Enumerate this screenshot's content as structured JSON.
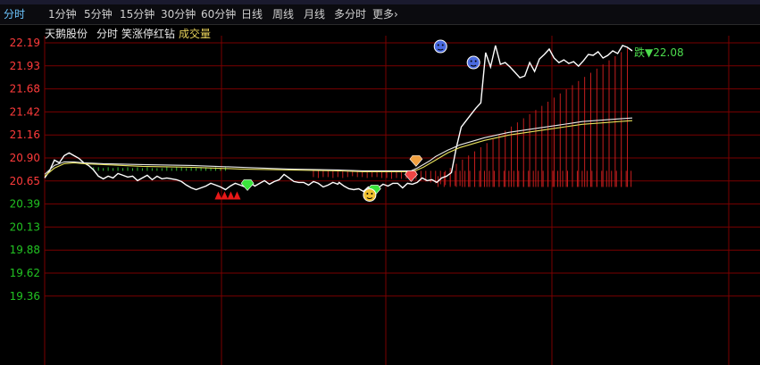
{
  "tabs": [
    {
      "label": "分时",
      "active": true
    },
    {
      "label": "1分钟"
    },
    {
      "label": "5分钟"
    },
    {
      "label": "15分钟"
    },
    {
      "label": "30分钟"
    },
    {
      "label": "60分钟"
    },
    {
      "label": "日线"
    },
    {
      "label": "周线"
    },
    {
      "label": "月线"
    },
    {
      "label": "多分时"
    },
    {
      "label": "更多"
    }
  ],
  "more_glyph": "›",
  "info": {
    "stock_name": "天鹅股份",
    "mode": "分时",
    "indicator": "笑涨停红钻",
    "volume_label": "成交量"
  },
  "colors": {
    "price_line": "#ffffff",
    "avg_line_yellow": "#e6e05a",
    "avg_line_white": "#e8e8e8",
    "grid": "#7a0000",
    "axis_up": "#ff3b3b",
    "axis_down": "#22c322",
    "bar_up": "#c41e1e",
    "bar_down": "#2fbf2f",
    "text_up": "#ff4d4d",
    "text_down": "#4ddc4d",
    "volume_label": "#e8d25a",
    "active_tab": "#6cc6ff"
  },
  "chart_data": {
    "type": "line",
    "ylim": [
      19.36,
      21.97
    ],
    "y_ticks": [
      "22.19",
      "21.93",
      "21.68",
      "21.42",
      "21.16",
      "20.90",
      "20.65",
      "20.39",
      "20.13",
      "19.88",
      "19.62",
      "19.36"
    ],
    "y_tick_up_count": 7,
    "series": [
      {
        "key": "price",
        "x": [
          0,
          4,
          8,
          12,
          16,
          20,
          24,
          28,
          32,
          36,
          40,
          44,
          48,
          52,
          56,
          60,
          64,
          68,
          72,
          76,
          80,
          84,
          88,
          92,
          96,
          100,
          104,
          108,
          112,
          116,
          120,
          124,
          128,
          132,
          136,
          140,
          144,
          148,
          152,
          156,
          160,
          164,
          168,
          172,
          176,
          180,
          184,
          188,
          192,
          196,
          200,
          204,
          208,
          212,
          216,
          220,
          224,
          228,
          232,
          236,
          240,
          241,
          245,
          249,
          253,
          257,
          261,
          265,
          269,
          273,
          277,
          281,
          285,
          289,
          293,
          297,
          301,
          305,
          309,
          313,
          317,
          321,
          325,
          329,
          333,
          337,
          341,
          345,
          349,
          353,
          357,
          361,
          365,
          369,
          373,
          377,
          381,
          385,
          389,
          393,
          397,
          401,
          405,
          409,
          413,
          417,
          421,
          425,
          429,
          433,
          437,
          441,
          445,
          449,
          453,
          457,
          461,
          465,
          469,
          473,
          477,
          481
        ],
        "values": [
          20.68,
          20.76,
          20.88,
          20.85,
          20.93,
          20.96,
          20.93,
          20.9,
          20.85,
          20.82,
          20.77,
          20.7,
          20.67,
          20.7,
          20.68,
          20.73,
          20.71,
          20.69,
          20.7,
          20.65,
          20.68,
          20.71,
          20.66,
          20.7,
          20.67,
          20.68,
          20.67,
          20.66,
          20.64,
          20.6,
          20.57,
          20.55,
          20.57,
          20.59,
          20.62,
          20.6,
          20.58,
          20.55,
          20.59,
          20.62,
          20.6,
          20.58,
          20.63,
          20.59,
          20.62,
          20.65,
          20.61,
          20.64,
          20.66,
          20.72,
          20.68,
          20.64,
          20.63,
          20.63,
          20.6,
          20.64,
          20.62,
          20.58,
          20.6,
          20.63,
          20.61,
          20.63,
          20.59,
          20.56,
          20.55,
          20.56,
          20.53,
          20.58,
          20.55,
          20.57,
          20.61,
          20.59,
          20.62,
          20.62,
          20.57,
          20.62,
          20.61,
          20.63,
          20.68,
          20.65,
          20.66,
          20.63,
          20.68,
          20.7,
          20.74,
          21.02,
          21.25,
          21.32,
          21.39,
          21.46,
          21.52,
          22.08,
          21.92,
          22.16,
          21.95,
          21.97,
          21.92,
          21.86,
          21.8,
          21.82,
          21.97,
          21.87,
          22.01,
          22.06,
          22.12,
          22.02,
          21.97,
          22.0,
          21.96,
          21.98,
          21.93,
          21.99,
          22.06,
          22.05,
          22.09,
          22.02,
          22.05,
          22.1,
          22.07,
          22.16,
          22.14,
          22.1
        ]
      },
      {
        "key": "avg_yellow",
        "x": [
          0,
          8,
          16,
          24,
          32,
          48,
          80,
          120,
          160,
          200,
          240,
          260,
          280,
          300,
          305,
          310,
          315,
          320,
          330,
          340,
          350,
          360,
          370,
          380,
          390,
          400,
          410,
          420,
          430,
          440,
          450,
          460,
          470,
          481
        ],
        "values": [
          20.7,
          20.79,
          20.84,
          20.85,
          20.84,
          20.83,
          20.81,
          20.8,
          20.78,
          20.77,
          20.76,
          20.75,
          20.75,
          20.75,
          20.77,
          20.8,
          20.84,
          20.88,
          20.96,
          21.02,
          21.06,
          21.1,
          21.13,
          21.16,
          21.18,
          21.2,
          21.22,
          21.24,
          21.26,
          21.28,
          21.29,
          21.3,
          21.31,
          21.32
        ]
      },
      {
        "key": "avg_white",
        "x": [
          0,
          8,
          16,
          24,
          32,
          48,
          80,
          120,
          160,
          200,
          240,
          260,
          280,
          300,
          305,
          310,
          315,
          320,
          330,
          340,
          350,
          360,
          370,
          380,
          390,
          400,
          410,
          420,
          430,
          440,
          450,
          460,
          470,
          481
        ],
        "values": [
          20.72,
          20.82,
          20.86,
          20.86,
          20.85,
          20.84,
          20.83,
          20.82,
          20.8,
          20.78,
          20.77,
          20.76,
          20.76,
          20.76,
          20.79,
          20.83,
          20.87,
          20.92,
          20.99,
          21.05,
          21.09,
          21.13,
          21.16,
          21.19,
          21.21,
          21.23,
          21.25,
          21.27,
          21.29,
          21.31,
          21.32,
          21.33,
          21.34,
          21.35
        ]
      }
    ],
    "signal_bars": {
      "base": 20.76,
      "x": [
        40,
        44,
        48,
        52,
        56,
        60,
        64,
        68,
        72,
        76,
        80,
        84,
        88,
        92,
        96,
        100,
        104,
        108,
        112,
        116,
        120,
        124,
        128,
        132,
        136,
        140,
        144,
        148,
        220,
        224,
        228,
        232,
        236,
        240,
        244,
        248,
        252,
        256,
        260,
        264,
        268,
        272,
        276,
        280,
        284,
        288,
        292,
        296,
        300,
        304,
        308,
        312,
        316,
        320,
        324,
        328,
        332,
        336,
        340,
        344,
        348,
        352,
        356,
        360,
        364,
        368,
        372,
        376,
        380,
        384,
        388,
        392,
        396,
        400,
        404,
        408,
        412,
        416,
        420,
        424,
        428,
        432,
        436,
        440,
        444,
        448,
        452,
        456,
        460,
        464,
        468,
        472,
        476,
        480
      ],
      "values": [
        20.8,
        20.8,
        20.79,
        20.8,
        20.79,
        20.8,
        20.79,
        20.8,
        20.79,
        20.8,
        20.79,
        20.8,
        20.79,
        20.79,
        20.79,
        20.8,
        20.79,
        20.8,
        20.8,
        20.79,
        20.8,
        20.79,
        20.8,
        20.8,
        20.79,
        20.8,
        20.79,
        20.8,
        20.69,
        20.68,
        20.69,
        20.69,
        20.68,
        20.69,
        20.68,
        20.69,
        20.7,
        20.69,
        20.69,
        20.68,
        20.69,
        20.69,
        20.68,
        20.68,
        20.67,
        20.68,
        20.67,
        20.67,
        20.66,
        20.66,
        20.65,
        20.64,
        20.63,
        20.62,
        20.61,
        20.6,
        20.6,
        20.59,
        20.59,
        20.58,
        20.58,
        20.58,
        20.58,
        20.58,
        20.58,
        20.58,
        20.58,
        20.58,
        20.58,
        20.58,
        20.58,
        20.58,
        20.58,
        20.58,
        20.58,
        20.58,
        20.58,
        20.58,
        20.58,
        20.58,
        20.58,
        20.58,
        20.58,
        20.58,
        20.58,
        20.58,
        20.58,
        20.58,
        20.58,
        20.58,
        20.58,
        20.58,
        20.58,
        20.58
      ]
    },
    "extra_ticks": [
      {
        "v": 21.27,
        "kind": "up"
      },
      {
        "v": 21.27,
        "kind": "up"
      }
    ],
    "markers": [
      {
        "x": 148,
        "v": 20.5,
        "kind": "red-fan"
      },
      {
        "x": 166,
        "v": 20.59,
        "kind": "green-gem"
      },
      {
        "x": 270,
        "v": 20.53,
        "kind": "green-gem"
      },
      {
        "x": 266,
        "v": 20.49,
        "kind": "yellow-face"
      },
      {
        "x": 300,
        "v": 20.69,
        "kind": "red-gem"
      },
      {
        "x": 304,
        "v": 20.86,
        "kind": "orange-gem"
      },
      {
        "x": 324,
        "v": 22.15,
        "kind": "blue-face"
      },
      {
        "x": 351,
        "v": 21.97,
        "kind": "blue-face"
      }
    ],
    "annotation": {
      "text": "跌▼22.08",
      "v": 22.08
    }
  }
}
